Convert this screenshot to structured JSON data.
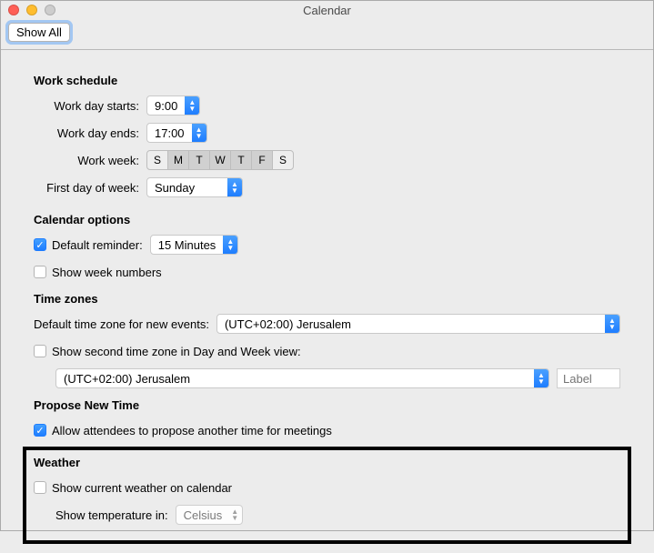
{
  "window": {
    "title": "Calendar"
  },
  "toolbar": {
    "show_all": "Show All"
  },
  "sections": {
    "work_schedule": {
      "title": "Work schedule",
      "start_label": "Work day starts:",
      "start_value": "9:00",
      "end_label": "Work day ends:",
      "end_value": "17:00",
      "week_label": "Work week:",
      "days": [
        {
          "letter": "S",
          "on": false
        },
        {
          "letter": "M",
          "on": true
        },
        {
          "letter": "T",
          "on": true
        },
        {
          "letter": "W",
          "on": true
        },
        {
          "letter": "T",
          "on": true
        },
        {
          "letter": "F",
          "on": true
        },
        {
          "letter": "S",
          "on": false
        }
      ],
      "first_day_label": "First day of week:",
      "first_day_value": "Sunday"
    },
    "calendar_options": {
      "title": "Calendar options",
      "default_reminder_label": "Default reminder:",
      "default_reminder_checked": true,
      "default_reminder_value": "15 Minutes",
      "show_week_numbers_label": "Show week numbers",
      "show_week_numbers_checked": false
    },
    "time_zones": {
      "title": "Time zones",
      "default_tz_label": "Default time zone for new events:",
      "default_tz_value": "(UTC+02:00) Jerusalem",
      "second_tz_label": "Show second time zone in Day and Week view:",
      "second_tz_checked": false,
      "second_tz_value": "(UTC+02:00) Jerusalem",
      "second_tz_input_placeholder": "Label"
    },
    "propose": {
      "title": "Propose New Time",
      "allow_label": "Allow attendees to propose another time for meetings",
      "allow_checked": true
    },
    "weather": {
      "title": "Weather",
      "show_label": "Show current weather on calendar",
      "show_checked": false,
      "temp_label": "Show temperature in:",
      "temp_value": "Celsius"
    }
  }
}
